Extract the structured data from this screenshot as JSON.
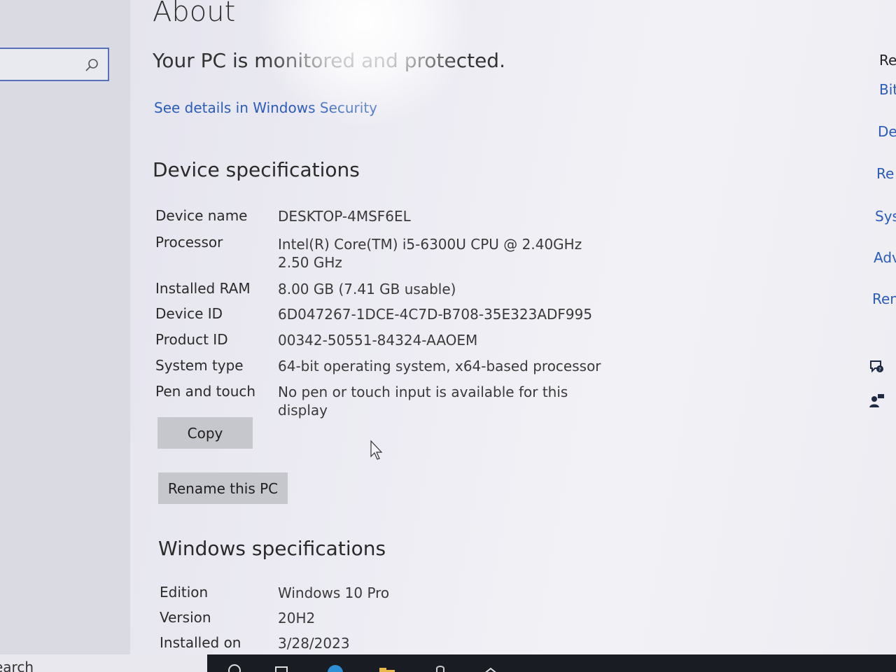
{
  "page": {
    "title": "About",
    "protection_text": "Your PC is monitored and protected.",
    "details_link": "See details in Windows Security"
  },
  "device_specs": {
    "heading": "Device specifications",
    "rows": [
      {
        "label": "Device name",
        "value": "DESKTOP-4MSF6EL"
      },
      {
        "label": "Processor",
        "value": "Intel(R) Core(TM) i5-6300U CPU @ 2.40GHz   2.50 GHz"
      },
      {
        "label": "Installed RAM",
        "value": "8.00 GB (7.41 GB usable)"
      },
      {
        "label": "Device ID",
        "value": "6D047267-1DCE-4C7D-B708-35E323ADF995"
      },
      {
        "label": "Product ID",
        "value": "00342-50551-84324-AAOEM"
      },
      {
        "label": "System type",
        "value": "64-bit operating system, x64-based processor"
      },
      {
        "label": "Pen and touch",
        "value": "No pen or touch input is available for this display"
      }
    ],
    "copy_label": "Copy",
    "rename_label": "Rename this PC"
  },
  "windows_specs": {
    "heading": "Windows specifications",
    "rows": [
      {
        "label": "Edition",
        "value": "Windows 10 Pro"
      },
      {
        "label": "Version",
        "value": "20H2"
      },
      {
        "label": "Installed on",
        "value": "3/28/2023"
      }
    ]
  },
  "related": {
    "heading": "Re",
    "links": [
      "Bit",
      "De",
      "Re",
      "Sys",
      "Adv",
      "Ren"
    ]
  },
  "taskbar": {
    "search_text": "earch"
  },
  "colors": {
    "accent": "#2a5cb8",
    "button": "#c6c6cd",
    "taskbar": "#1a1c24"
  }
}
